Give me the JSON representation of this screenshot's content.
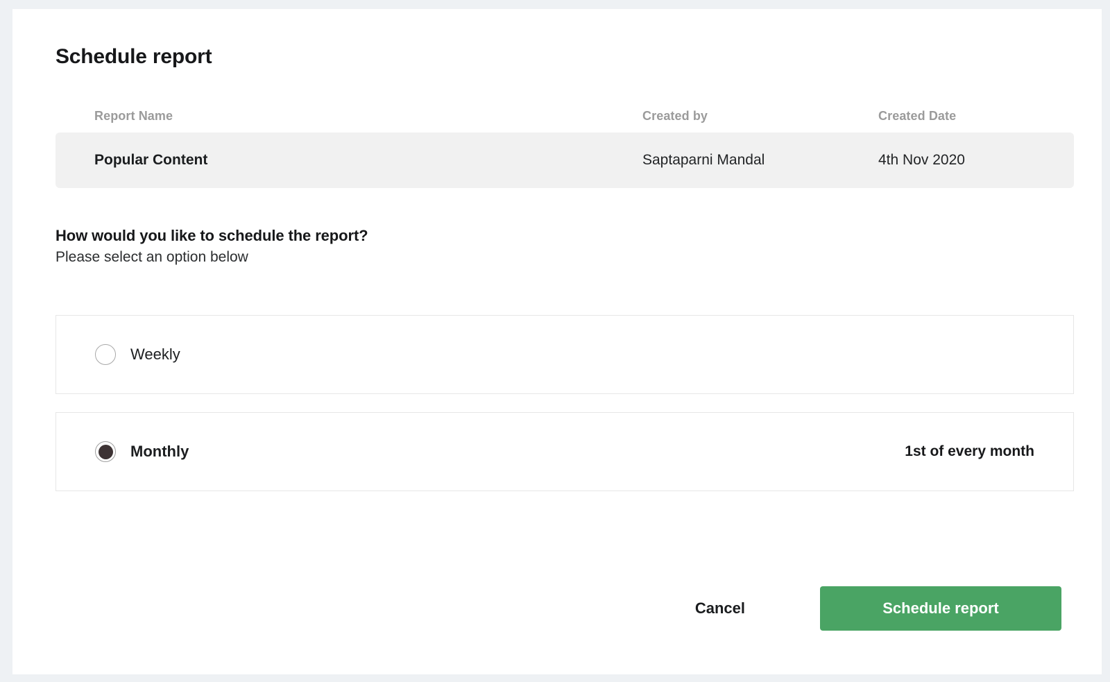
{
  "page": {
    "background": "#eef1f4",
    "modal_background": "#ffffff",
    "title": "Schedule report"
  },
  "report_table": {
    "columns": {
      "name": "Report Name",
      "created_by": "Created by",
      "created_date": "Created Date"
    },
    "rows": [
      {
        "name": "Popular Content",
        "created_by": "Saptaparni Mandal",
        "created_date": "4th Nov 2020"
      }
    ]
  },
  "question": {
    "title": "How would you like to schedule the report?",
    "subtitle": "Please select an option below"
  },
  "options": {
    "selected": "monthly",
    "items": [
      {
        "id": "weekly",
        "label": "Weekly",
        "meta": "",
        "selected": false
      },
      {
        "id": "monthly",
        "label": "Monthly",
        "meta": "1st of every month",
        "selected": true
      }
    ]
  },
  "footer": {
    "cancel_label": "Cancel",
    "submit_label": "Schedule report",
    "submit_color": "#4aa464"
  }
}
